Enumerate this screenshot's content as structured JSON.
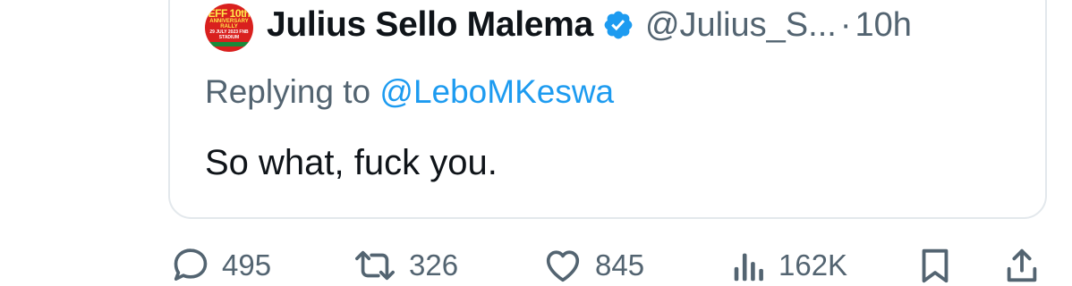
{
  "quoted_tweet": {
    "avatar_text": {
      "line1": "EFF 10th",
      "line2": "ANNIVERSARY RALLY",
      "line3": "29 JULY 2023 FNB STADIUM"
    },
    "display_name": "Julius Sello Malema",
    "verified": true,
    "handle": "@Julius_S...",
    "separator": "·",
    "time": "10h",
    "replying_prefix": "Replying to ",
    "replying_handle": "@LeboMKeswa",
    "text": "So what, fuck you."
  },
  "actions": {
    "replies": "495",
    "retweets": "326",
    "likes": "845",
    "views": "162K"
  },
  "colors": {
    "primary_text": "#0f1419",
    "secondary_text": "#536471",
    "link": "#1d9bf0",
    "verified": "#1d9bf0",
    "border": "#e3e8ec"
  },
  "icons": {
    "replies": "comment-icon",
    "retweets": "retweet-icon",
    "likes": "heart-icon",
    "views": "views-icon",
    "bookmark": "bookmark-icon",
    "share": "share-icon",
    "verified": "verified-badge-icon"
  }
}
